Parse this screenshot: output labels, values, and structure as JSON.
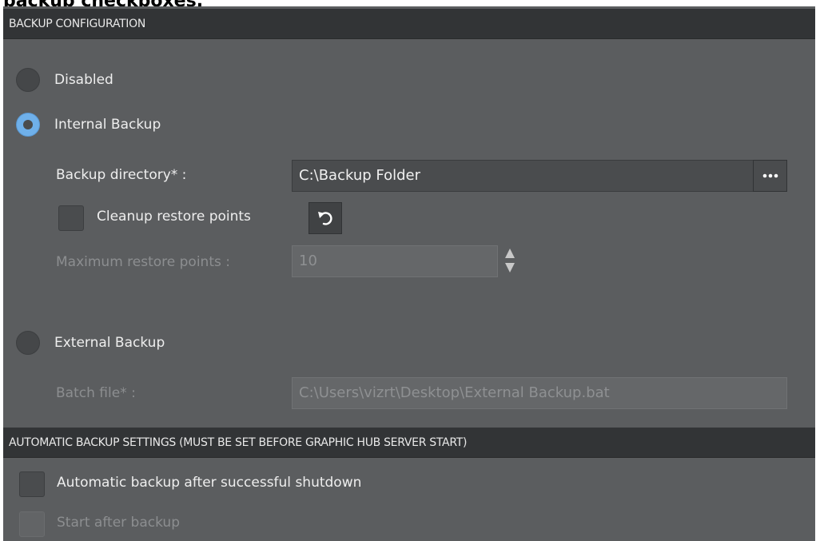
{
  "caption": "backup checkboxes.",
  "backup_configuration": {
    "header": "BACKUP CONFIGURATION",
    "options": {
      "disabled": {
        "label": "Disabled",
        "selected": false
      },
      "internal": {
        "label": "Internal Backup",
        "selected": true
      },
      "external": {
        "label": "External Backup",
        "selected": false
      }
    },
    "internal": {
      "directory_label": "Backup directory* :",
      "directory_value": "C:\\Backup Folder",
      "browse_icon": "ellipsis-icon",
      "cleanup_label": "Cleanup restore points",
      "cleanup_checked": false,
      "reset_icon": "undo-icon",
      "max_restore_label": "Maximum restore points :",
      "max_restore_value": "10",
      "spin_icon": "spinner-arrows-icon"
    },
    "external": {
      "batch_label": "Batch file* :",
      "batch_value": "C:\\Users\\vizrt\\Desktop\\External Backup.bat"
    }
  },
  "automatic_backup": {
    "header": "AUTOMATIC BACKUP SETTINGS (MUST BE SET BEFORE GRAPHIC HUB SERVER START)",
    "after_shutdown_label": "Automatic backup after successful shutdown",
    "after_shutdown_checked": false,
    "start_after_label": "Start after backup",
    "start_after_checked": false
  },
  "colors": {
    "panel": "#5b5d5f",
    "header": "#323436",
    "accent": "#6fb0ea",
    "field": "#4a4c4e"
  }
}
